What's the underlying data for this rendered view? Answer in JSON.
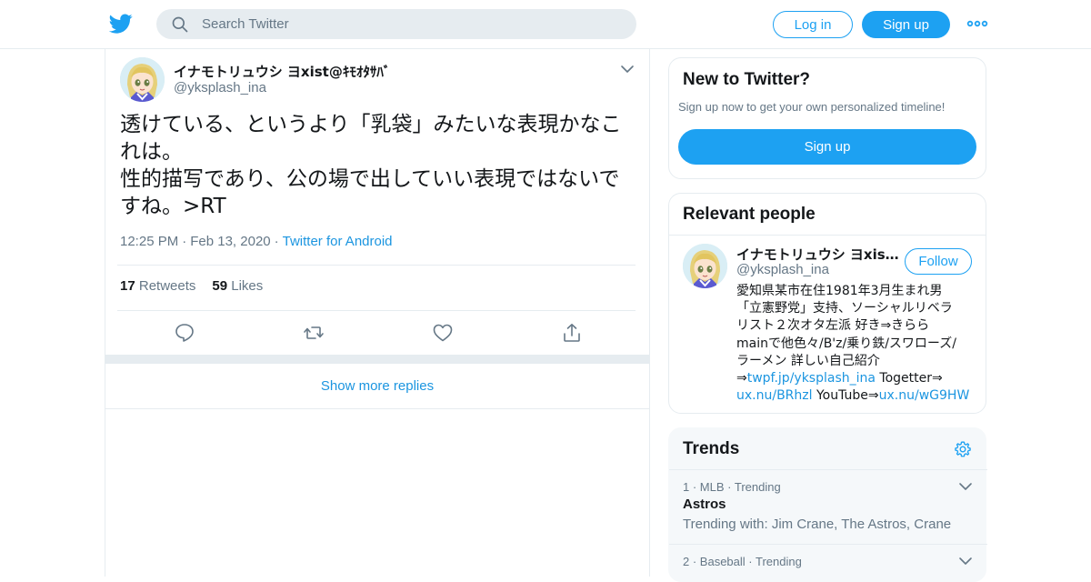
{
  "header": {
    "logo_icon": "twitter-bird-icon",
    "search_placeholder": "Search Twitter",
    "login_label": "Log in",
    "signup_label": "Sign up",
    "more_icon": "more-dots-icon",
    "accent": "#1da1f2"
  },
  "tweet": {
    "author_name": "イナモトリュウシ ヨxist@ｷﾓｵﾀｻﾊﾞ",
    "author_handle": "@yksplash_ina",
    "text_lines": [
      "透けている、というより「乳袋」みたいな表現かなこ",
      "れは。",
      "性的描写であり、公の場で出していい表現ではないで",
      "すね。>RT"
    ],
    "time": "12:25 PM",
    "date": "Feb 13, 2020",
    "source": "Twitter for Android",
    "retweets_count": "17",
    "retweets_label": "Retweets",
    "likes_count": "59",
    "likes_label": "Likes",
    "show_more_label": "Show more replies"
  },
  "sidebar": {
    "new_title": "New to Twitter?",
    "new_subtitle": "Sign up now to get your own personalized timeline!",
    "new_button": "Sign up",
    "people_title": "Relevant people",
    "person_name": "イナモトリュウシ ヨxist@ｷﾓｵﾀｻﾊﾞ",
    "person_handle": "@yksplash_ina",
    "follow_label": "Follow",
    "bio": {
      "line1": "愛知県某市在住1981年3月生まれ男",
      "line2": "「立憲野党」支持、ソーシャルリベラ",
      "line3": "リスト２次オタ左派 好き⇒きらら",
      "line4": "mainで他色々/B'z/乗り鉄/スワローズ/",
      "line5": "ラーメン 詳しい自己紹介",
      "arrow1": "⇒",
      "link1": "twpf.jp/yksplash_ina",
      "mid1": " Togetter⇒",
      "link2": "ux.nu/BRhzl",
      "mid2": " YouTube⇒",
      "link3": "ux.nu/wG9HW"
    },
    "trends_title": "Trends",
    "trends": [
      {
        "rank": "1",
        "category": "MLB",
        "status": "Trending",
        "name": "Astros",
        "with": "Trending with: Jim Crane, The Astros, Crane"
      },
      {
        "rank": "2",
        "category": "Baseball",
        "status": "Trending"
      }
    ]
  }
}
